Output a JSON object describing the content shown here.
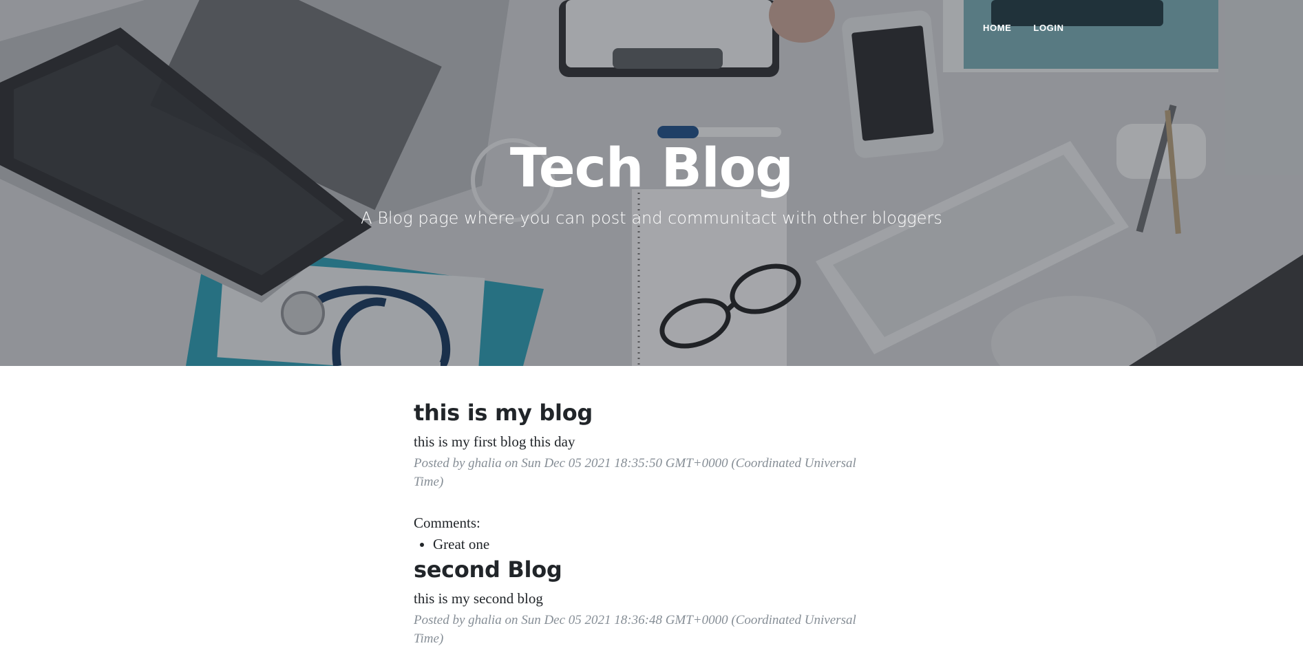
{
  "nav": {
    "home": "HOME",
    "login": "LOGIN"
  },
  "hero": {
    "title": "Tech Blog",
    "subtitle": "A Blog page where you can post and communitact with other bloggers"
  },
  "posts": [
    {
      "title": "this is my blog",
      "body": "this is my first blog this day",
      "meta": "Posted by ghalia on Sun Dec 05 2021 18:35:50 GMT+0000 (Coordinated Universal Time)",
      "comments_label": "Comments:",
      "comments": [
        "Great one"
      ]
    },
    {
      "title": "second Blog",
      "body": "this is my second blog",
      "meta": "Posted by ghalia on Sun Dec 05 2021 18:36:48 GMT+0000 (Coordinated Universal Time)"
    }
  ],
  "colors": {
    "overlay": "#212529",
    "meta_text": "#868e96",
    "accent_folder": "#2a9fb6"
  }
}
